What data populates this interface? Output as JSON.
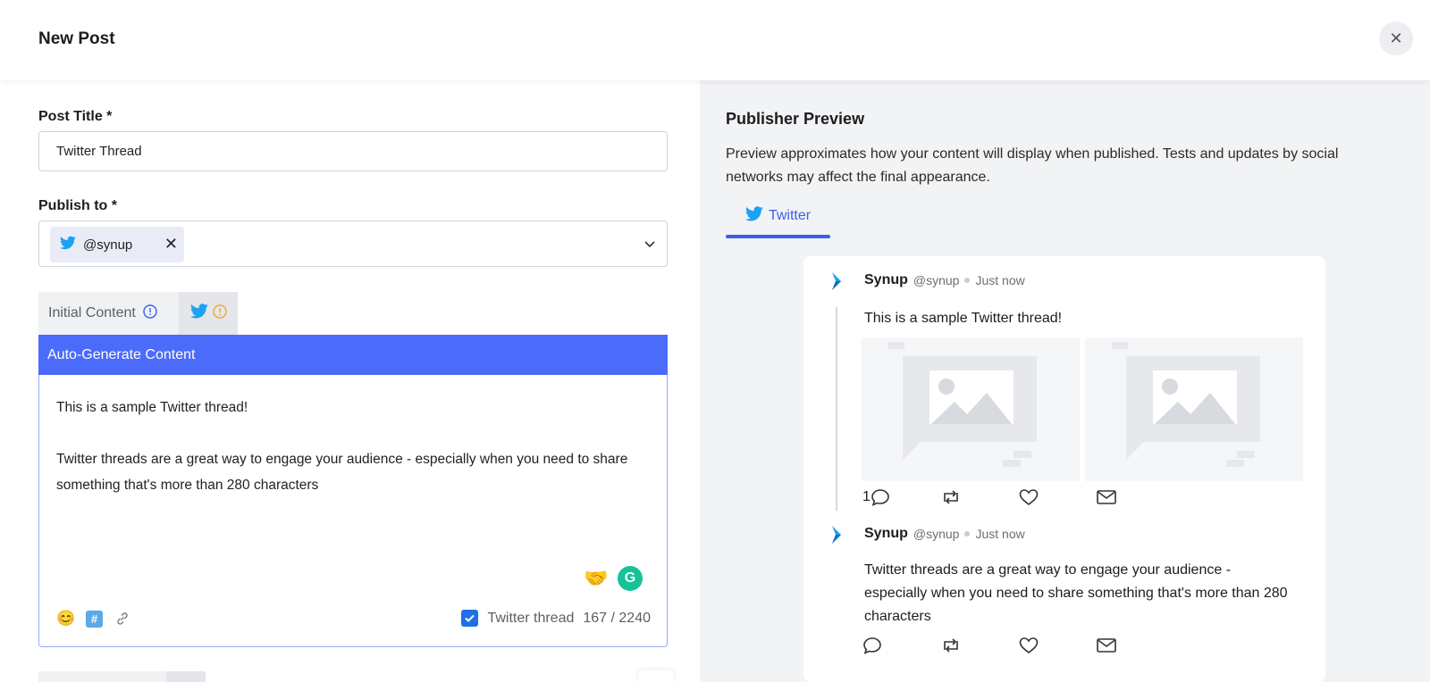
{
  "header": {
    "title": "New Post"
  },
  "form": {
    "post_title_label": "Post Title *",
    "post_title_value": "Twitter Thread",
    "publish_to_label": "Publish to *",
    "publish_to_chip": "@synup"
  },
  "content_tabs": [
    {
      "label": "Initial Content"
    }
  ],
  "auto_generate_label": "Auto-Generate Content",
  "editor": {
    "paragraphs": [
      "This is a sample Twitter thread!",
      "Twitter threads are a great way to engage your audience - especially when you need to share something that's more than 280 characters"
    ],
    "thread_label": "Twitter thread",
    "thread_checked": true,
    "counter": "167 / 2240"
  },
  "preview": {
    "title": "Publisher Preview",
    "description": "Preview approximates how your content will display when published. Tests and updates by social networks may affect the final appearance.",
    "tab_label": "Twitter",
    "tweets": [
      {
        "name": "Synup",
        "handle": "@synup",
        "time": "Just now",
        "text": "This is a sample Twitter thread!",
        "reply_count": "1"
      },
      {
        "name": "Synup",
        "handle": "@synup",
        "time": "Just now",
        "text": "Twitter threads are a great way to engage your audience - especially when you need to share something that's more than 280 characters",
        "reply_count": ""
      }
    ]
  },
  "colors": {
    "accent": "#4b6bfb",
    "twitter": "#1da1f2",
    "link": "#3b5ef0",
    "warning": "#f5a623",
    "grammarly": "#15c39a"
  },
  "icons": {
    "close": "close-icon",
    "chevron": "chevron-down-icon",
    "twitter": "twitter-bird-icon",
    "info": "info-icon",
    "warning": "warning-icon",
    "emoji": "emoji-icon",
    "hashtag": "hashtag-icon",
    "link": "link-icon",
    "reply": "reply-icon",
    "retweet": "retweet-icon",
    "like": "heart-icon",
    "mail": "mail-icon"
  }
}
